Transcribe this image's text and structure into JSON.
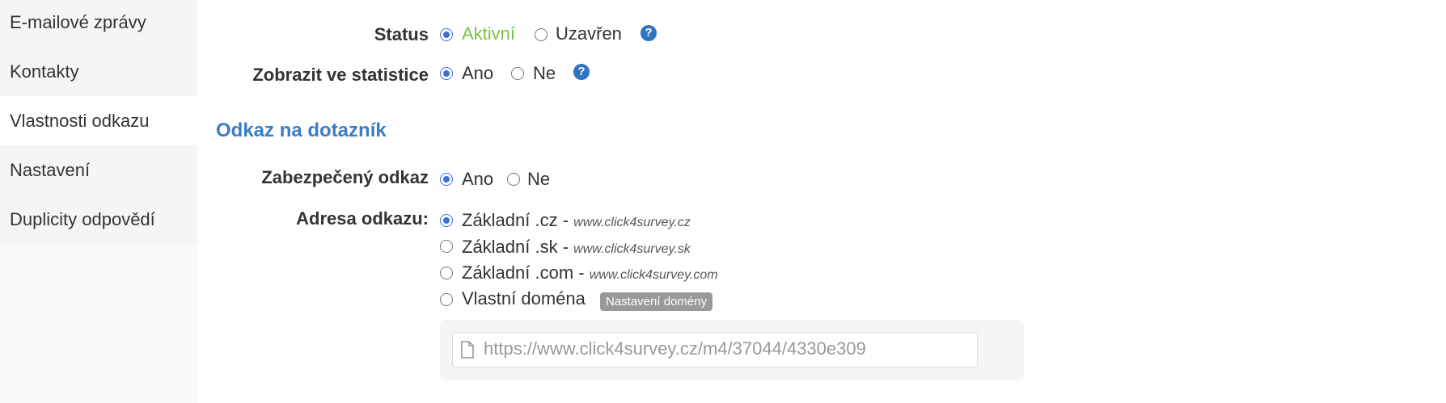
{
  "sidebar": {
    "items": [
      {
        "label": "E-mailové zprávy"
      },
      {
        "label": "Kontakty"
      },
      {
        "label": "Vlastnosti odkazu"
      },
      {
        "label": "Nastavení"
      },
      {
        "label": "Duplicity odpovědí"
      }
    ],
    "active_index": 2
  },
  "status": {
    "label": "Status",
    "options": [
      "Aktivní",
      "Uzavřen"
    ],
    "selected": "Aktivní",
    "help_icon": "?"
  },
  "statistics": {
    "label": "Zobrazit ve statistice",
    "options": [
      "Ano",
      "Ne"
    ],
    "selected": "Ano",
    "help_icon": "?"
  },
  "section_title": "Odkaz na dotazník",
  "secure_link": {
    "label": "Zabezpečený odkaz",
    "options": [
      "Ano",
      "Ne"
    ],
    "selected": "Ano"
  },
  "link_address": {
    "label": "Adresa odkazu:",
    "options": [
      {
        "label": "Základní .cz - ",
        "hint": "www.click4survey.cz",
        "checked": true
      },
      {
        "label": "Základní .sk - ",
        "hint": "www.click4survey.sk",
        "checked": false
      },
      {
        "label": "Základní .com - ",
        "hint": "www.click4survey.com",
        "checked": false
      },
      {
        "label": "Vlastní doména",
        "hint": "",
        "checked": false
      }
    ],
    "domain_settings_badge": "Nastavení domény",
    "url_value": "https://www.click4survey.cz/m4/37044/4330e309"
  },
  "colors": {
    "accent_blue": "#3b6fe0",
    "section_blue": "#3b7dc3",
    "active_green": "#7bc143",
    "help_blue": "#2f74c0",
    "badge_gray": "#999999"
  },
  "icons": {
    "help": "question-circle-icon",
    "file": "file-icon"
  }
}
